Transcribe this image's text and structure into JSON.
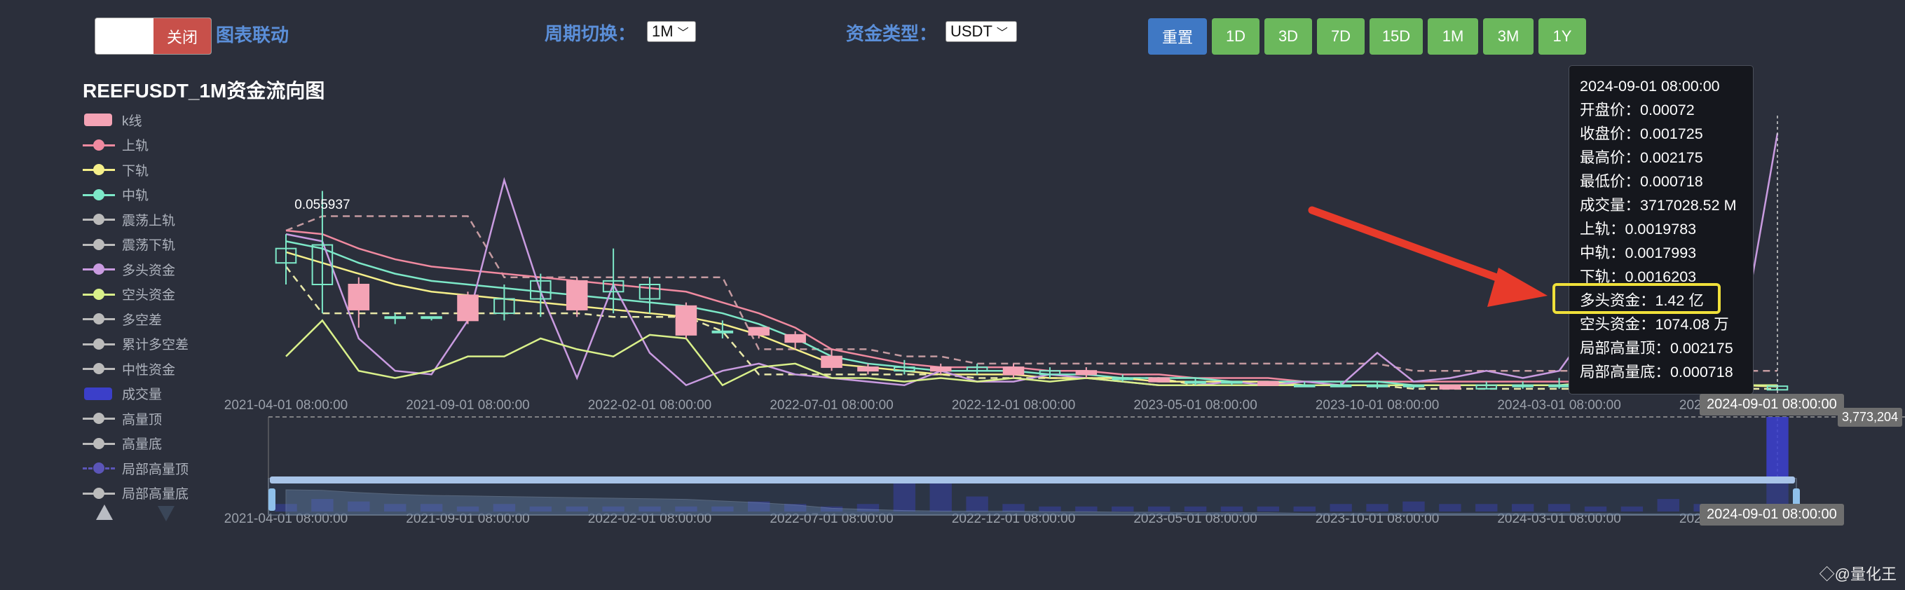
{
  "toolbar": {
    "toggle_label": "关闭",
    "link_label": "图表联动",
    "period_label": "周期切换：",
    "period_value": "1M",
    "fund_label": "资金类型：",
    "fund_value": "USDT",
    "reset_label": "重置",
    "period_buttons": [
      "1D",
      "3D",
      "7D",
      "15D",
      "1M",
      "3M",
      "1Y"
    ]
  },
  "title": "REEFUSDT_1M资金流向图",
  "legend": [
    {
      "label": "k线",
      "color": "#f4a3b5",
      "kind": "rect"
    },
    {
      "label": "上轨",
      "color": "#f08aa0",
      "kind": "line"
    },
    {
      "label": "下轨",
      "color": "#f5ef8a",
      "kind": "line"
    },
    {
      "label": "中轨",
      "color": "#7de8c8",
      "kind": "line"
    },
    {
      "label": "震荡上轨",
      "color": "#bbbbbb",
      "kind": "line"
    },
    {
      "label": "震荡下轨",
      "color": "#bbbbbb",
      "kind": "line"
    },
    {
      "label": "多头资金",
      "color": "#c99be0",
      "kind": "line"
    },
    {
      "label": "空头资金",
      "color": "#d9f08a",
      "kind": "line"
    },
    {
      "label": "多空差",
      "color": "#bbbbbb",
      "kind": "line"
    },
    {
      "label": "累计多空差",
      "color": "#bbbbbb",
      "kind": "line"
    },
    {
      "label": "中性资金",
      "color": "#bbbbbb",
      "kind": "line"
    },
    {
      "label": "成交量",
      "color": "#3b3fc9",
      "kind": "rect"
    },
    {
      "label": "高量顶",
      "color": "#bbbbbb",
      "kind": "line"
    },
    {
      "label": "高量底",
      "color": "#bbbbbb",
      "kind": "line"
    },
    {
      "label": "局部高量顶",
      "color": "#5b55b8",
      "kind": "dashed"
    },
    {
      "label": "局部高量底",
      "color": "#bbbbbb",
      "kind": "line"
    }
  ],
  "tooltip": [
    "2024-09-01 08:00:00",
    "开盘价：0.00072",
    "收盘价：0.001725",
    "最高价：0.002175",
    "最低价：0.000718",
    "成交量：3717028.52 M",
    "上轨：0.0019783",
    "中轨：0.0017993",
    "下轨：0.0016203",
    "多头资金：1.42 亿",
    "空头资金：1074.08 万",
    "局部高量顶：0.002175",
    "局部高量底：0.000718"
  ],
  "axis_tag": "2024-09-01 08:00:00",
  "volume_max_tag": "3,773,204",
  "watermark": "◇@量化王",
  "chart_data": {
    "type": "line",
    "max_label": "0.055937",
    "x_ticks": [
      "2021-04-01 08:00:00",
      "2021-09-01 08:00:00",
      "2022-02-01 08:00:00",
      "2022-07-01 08:00:00",
      "2022-12-01 08:00:00",
      "2023-05-01 08:00:00",
      "2023-10-01 08:00:00",
      "2024-03-01 08:00:00",
      "2024-09-01 08:00:00"
    ],
    "n": 42,
    "candles": [
      {
        "o": 0.036,
        "c": 0.04,
        "h": 0.044,
        "l": 0.03
      },
      {
        "o": 0.03,
        "c": 0.041,
        "h": 0.056,
        "l": 0.022
      },
      {
        "o": 0.03,
        "c": 0.023,
        "h": 0.032,
        "l": 0.018
      },
      {
        "o": 0.021,
        "c": 0.021,
        "h": 0.022,
        "l": 0.019
      },
      {
        "o": 0.021,
        "c": 0.021,
        "h": 0.021,
        "l": 0.02
      },
      {
        "o": 0.027,
        "c": 0.02,
        "h": 0.028,
        "l": 0.019
      },
      {
        "o": 0.022,
        "c": 0.026,
        "h": 0.03,
        "l": 0.02
      },
      {
        "o": 0.026,
        "c": 0.031,
        "h": 0.033,
        "l": 0.021
      },
      {
        "o": 0.031,
        "c": 0.023,
        "h": 0.032,
        "l": 0.021
      },
      {
        "o": 0.028,
        "c": 0.031,
        "h": 0.04,
        "l": 0.022
      },
      {
        "o": 0.026,
        "c": 0.03,
        "h": 0.032,
        "l": 0.022
      },
      {
        "o": 0.024,
        "c": 0.016,
        "h": 0.025,
        "l": 0.015
      },
      {
        "o": 0.017,
        "c": 0.017,
        "h": 0.02,
        "l": 0.015
      },
      {
        "o": 0.018,
        "c": 0.016,
        "h": 0.018,
        "l": 0.015
      },
      {
        "o": 0.016,
        "c": 0.014,
        "h": 0.017,
        "l": 0.012
      },
      {
        "o": 0.01,
        "c": 0.007,
        "h": 0.012,
        "l": 0.006
      },
      {
        "o": 0.007,
        "c": 0.006,
        "h": 0.008,
        "l": 0.005
      },
      {
        "o": 0.006,
        "c": 0.007,
        "h": 0.009,
        "l": 0.005
      },
      {
        "o": 0.007,
        "c": 0.006,
        "h": 0.008,
        "l": 0.005
      },
      {
        "o": 0.006,
        "c": 0.007,
        "h": 0.008,
        "l": 0.005
      },
      {
        "o": 0.007,
        "c": 0.005,
        "h": 0.008,
        "l": 0.004
      },
      {
        "o": 0.005,
        "c": 0.006,
        "h": 0.007,
        "l": 0.004
      },
      {
        "o": 0.006,
        "c": 0.005,
        "h": 0.007,
        "l": 0.004
      },
      {
        "o": 0.004,
        "c": 0.004,
        "h": 0.005,
        "l": 0.003
      },
      {
        "o": 0.004,
        "c": 0.003,
        "h": 0.004,
        "l": 0.003
      },
      {
        "o": 0.003,
        "c": 0.003,
        "h": 0.004,
        "l": 0.002
      },
      {
        "o": 0.003,
        "c": 0.003,
        "h": 0.003,
        "l": 0.002
      },
      {
        "o": 0.003,
        "c": 0.002,
        "h": 0.003,
        "l": 0.002
      },
      {
        "o": 0.002,
        "c": 0.002,
        "h": 0.003,
        "l": 0.002
      },
      {
        "o": 0.002,
        "c": 0.002,
        "h": 0.003,
        "l": 0.002
      },
      {
        "o": 0.002,
        "c": 0.002,
        "h": 0.003,
        "l": 0.001
      },
      {
        "o": 0.002,
        "c": 0.002,
        "h": 0.002,
        "l": 0.001
      },
      {
        "o": 0.002,
        "c": 0.001,
        "h": 0.002,
        "l": 0.001
      },
      {
        "o": 0.001,
        "c": 0.002,
        "h": 0.003,
        "l": 0.001
      },
      {
        "o": 0.002,
        "c": 0.002,
        "h": 0.003,
        "l": 0.001
      },
      {
        "o": 0.002,
        "c": 0.002,
        "h": 0.004,
        "l": 0.001
      },
      {
        "o": 0.002,
        "c": 0.001,
        "h": 0.002,
        "l": 0.001
      },
      {
        "o": 0.001,
        "c": 0.001,
        "h": 0.002,
        "l": 0.001
      },
      {
        "o": 0.001,
        "c": 0.001,
        "h": 0.002,
        "l": 0.001
      },
      {
        "o": 0.001,
        "c": 0.001,
        "h": 0.001,
        "l": 0.0007
      },
      {
        "o": 0.001,
        "c": 0.0007,
        "h": 0.001,
        "l": 0.0006
      },
      {
        "o": 0.00072,
        "c": 0.001725,
        "h": 0.002175,
        "l": 0.000718
      }
    ],
    "series": [
      {
        "name": "上轨",
        "color": "#f08aa0",
        "values": [
          0.045,
          0.044,
          0.04,
          0.037,
          0.035,
          0.034,
          0.033,
          0.032,
          0.031,
          0.03,
          0.029,
          0.028,
          0.025,
          0.022,
          0.018,
          0.012,
          0.01,
          0.008,
          0.007,
          0.007,
          0.007,
          0.006,
          0.006,
          0.005,
          0.005,
          0.004,
          0.004,
          0.004,
          0.003,
          0.003,
          0.003,
          0.003,
          0.003,
          0.003,
          0.003,
          0.003,
          0.003,
          0.002,
          0.002,
          0.002,
          0.002,
          0.002
        ]
      },
      {
        "name": "中轨",
        "color": "#7de8c8",
        "values": [
          0.042,
          0.04,
          0.036,
          0.033,
          0.031,
          0.03,
          0.029,
          0.028,
          0.027,
          0.026,
          0.025,
          0.024,
          0.022,
          0.019,
          0.015,
          0.01,
          0.008,
          0.007,
          0.006,
          0.006,
          0.006,
          0.005,
          0.005,
          0.004,
          0.004,
          0.004,
          0.003,
          0.003,
          0.003,
          0.003,
          0.003,
          0.002,
          0.002,
          0.002,
          0.002,
          0.002,
          0.002,
          0.002,
          0.002,
          0.002,
          0.002,
          0.0018
        ]
      },
      {
        "name": "下轨",
        "color": "#f5ef8a",
        "values": [
          0.039,
          0.036,
          0.033,
          0.03,
          0.028,
          0.027,
          0.026,
          0.025,
          0.024,
          0.023,
          0.022,
          0.021,
          0.019,
          0.016,
          0.012,
          0.008,
          0.007,
          0.006,
          0.005,
          0.005,
          0.005,
          0.004,
          0.004,
          0.004,
          0.003,
          0.003,
          0.003,
          0.003,
          0.002,
          0.002,
          0.002,
          0.002,
          0.002,
          0.002,
          0.002,
          0.002,
          0.002,
          0.002,
          0.002,
          0.002,
          0.002,
          0.0016
        ]
      },
      {
        "name": "多头资金",
        "color": "#c99be0",
        "values": [
          0.044,
          0.042,
          0.015,
          0.006,
          0.005,
          0.02,
          0.059,
          0.028,
          0.004,
          0.03,
          0.011,
          0.002,
          0.006,
          0.008,
          0.005,
          0.004,
          0.003,
          0.002,
          0.006,
          0.003,
          0.003,
          0.005,
          0.004,
          0.003,
          0.002,
          0.002,
          0.003,
          0.002,
          0.003,
          0.002,
          0.011,
          0.003,
          0.004,
          0.006,
          0.004,
          0.006,
          0.02,
          0.015,
          0.012,
          0.006,
          0.014,
          0.072
        ]
      },
      {
        "name": "空头资金",
        "color": "#d9f08a",
        "values": [
          0.01,
          0.02,
          0.006,
          0.004,
          0.006,
          0.01,
          0.01,
          0.015,
          0.012,
          0.01,
          0.016,
          0.015,
          0.002,
          0.007,
          0.008,
          0.004,
          0.004,
          0.003,
          0.004,
          0.003,
          0.004,
          0.003,
          0.004,
          0.003,
          0.002,
          0.002,
          0.002,
          0.002,
          0.002,
          0.002,
          0.002,
          0.002,
          0.002,
          0.002,
          0.002,
          0.002,
          0.003,
          0.002,
          0.002,
          0.002,
          0.002,
          0.002
        ]
      }
    ],
    "osc_upper": [
      0.045,
      0.049,
      0.049,
      0.049,
      0.049,
      0.049,
      0.032,
      0.032,
      0.032,
      0.032,
      0.032,
      0.032,
      0.032,
      0.012,
      0.012,
      0.012,
      0.012,
      0.01,
      0.01,
      0.008,
      0.008,
      0.008,
      0.008,
      0.008,
      0.008,
      0.008,
      0.008,
      0.008,
      0.008,
      0.008,
      0.008,
      0.006,
      0.006,
      0.006,
      0.006,
      0.006,
      0.006,
      0.006,
      0.006,
      0.006,
      0.006,
      0.006
    ],
    "osc_lower": [
      0.035,
      0.022,
      0.022,
      0.022,
      0.022,
      0.022,
      0.022,
      0.022,
      0.022,
      0.021,
      0.021,
      0.021,
      0.017,
      0.005,
      0.005,
      0.005,
      0.005,
      0.005,
      0.005,
      0.004,
      0.004,
      0.004,
      0.004,
      0.004,
      0.004,
      0.002,
      0.002,
      0.002,
      0.002,
      0.002,
      0.002,
      0.001,
      0.001,
      0.001,
      0.001,
      0.001,
      0.001,
      0.001,
      0.001,
      0.001,
      0.001,
      0.001
    ],
    "volume": [
      0.3,
      0.5,
      0.4,
      0.3,
      0.3,
      0.2,
      0.3,
      0.2,
      0.2,
      0.2,
      0.2,
      0.2,
      0.2,
      0.4,
      0.3,
      0.2,
      0.3,
      1.2,
      1.2,
      0.6,
      0.3,
      0.2,
      0.2,
      0.2,
      0.2,
      0.2,
      0.2,
      0.2,
      0.2,
      0.3,
      0.3,
      0.4,
      0.3,
      0.3,
      0.3,
      0.3,
      0.2,
      0.2,
      0.5,
      0.3,
      0.2,
      3.773
    ]
  }
}
